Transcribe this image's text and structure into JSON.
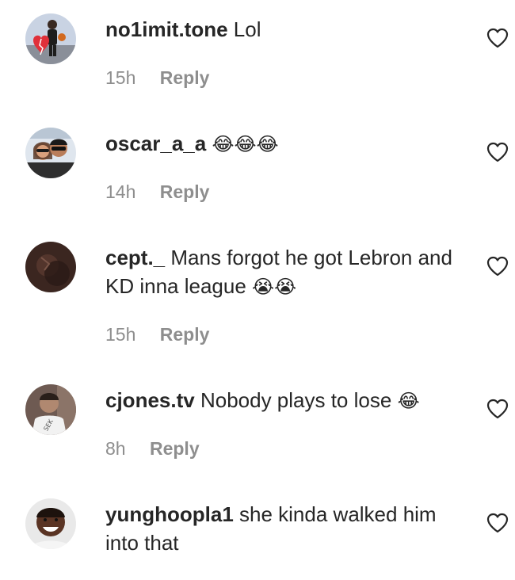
{
  "comments": [
    {
      "username": "no1imit.tone",
      "text": "Lol",
      "emoji": "",
      "time": "15h",
      "reply_label": "Reply",
      "avatar_icon": "avatar-broken-heart-photo"
    },
    {
      "username": "oscar_a_a",
      "text": "",
      "emoji": "😂😂😂",
      "time": "14h",
      "reply_label": "Reply",
      "avatar_icon": "avatar-couple-photo"
    },
    {
      "username": "cept._",
      "text": "Mans forgot he got Lebron and KD inna league",
      "emoji": "😭😭",
      "time": "15h",
      "reply_label": "Reply",
      "avatar_icon": "avatar-dark-photo"
    },
    {
      "username": "cjones.tv",
      "text": "Nobody plays to lose",
      "emoji": "😂",
      "time": "8h",
      "reply_label": "Reply",
      "avatar_icon": "avatar-profile-photo"
    },
    {
      "username": "yunghoopla1",
      "text": "she kinda walked him into that",
      "emoji": "",
      "time": "",
      "reply_label": "",
      "avatar_icon": "avatar-smiling-photo"
    }
  ],
  "colors": {
    "text": "#262626",
    "meta": "#8e8e8e",
    "background": "#ffffff"
  }
}
